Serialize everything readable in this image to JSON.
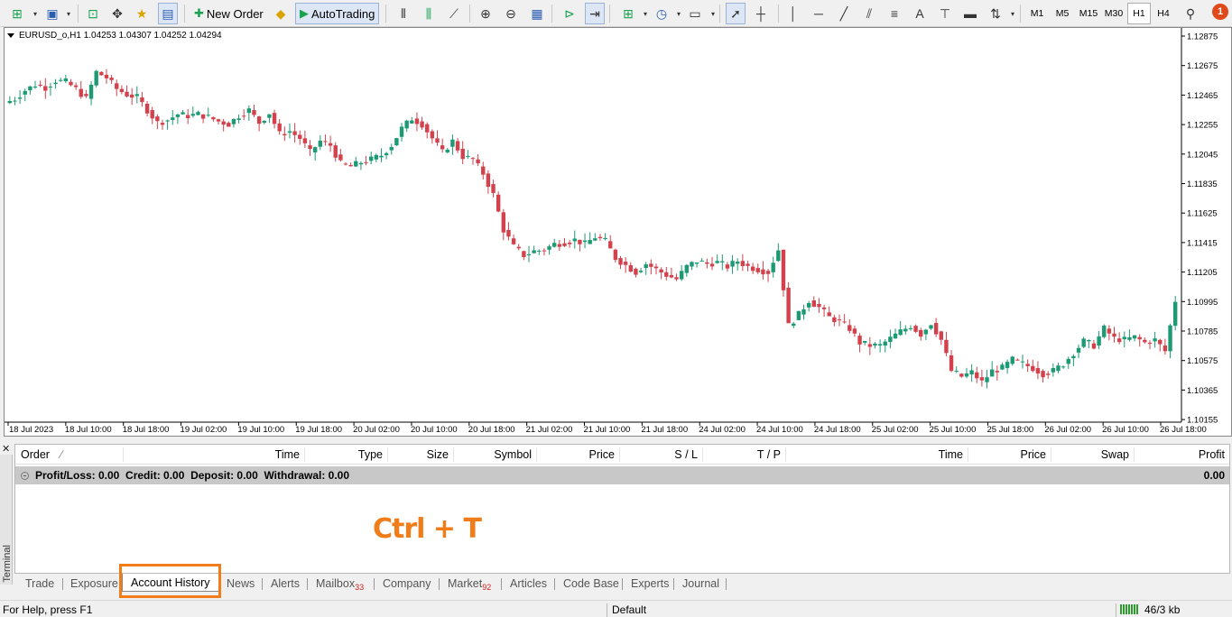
{
  "toolbar": {
    "new_order": "New Order",
    "auto_trading": "AutoTrading",
    "timeframes": [
      "M1",
      "M5",
      "M15",
      "M30",
      "H1",
      "H4"
    ],
    "active_timeframe": "H1",
    "tools": [
      "A"
    ],
    "notifications": "1"
  },
  "chart": {
    "title": "EURUSD_o,H1  1.04253 1.04307 1.04252 1.04294",
    "colors": {
      "up": "#1c9a73",
      "down": "#d3414d"
    }
  },
  "chart_data": {
    "type": "candlestick",
    "symbol": "EURUSD_o",
    "timeframe": "H1",
    "y_ticks": [
      "1.12875",
      "1.12675",
      "1.12465",
      "1.12255",
      "1.12045",
      "1.11835",
      "1.11625",
      "1.11415",
      "1.11205",
      "1.10995",
      "1.10785",
      "1.10575",
      "1.10365",
      "1.10155"
    ],
    "x_ticks": [
      "18 Jul 2023",
      "18 Jul 10:00",
      "18 Jul 18:00",
      "19 Jul 02:00",
      "19 Jul 10:00",
      "19 Jul 18:00",
      "20 Jul 02:00",
      "20 Jul 10:00",
      "20 Jul 18:00",
      "21 Jul 02:00",
      "21 Jul 10:00",
      "21 Jul 18:00",
      "24 Jul 02:00",
      "24 Jul 10:00",
      "24 Jul 18:00",
      "25 Jul 02:00",
      "25 Jul 10:00",
      "25 Jul 18:00",
      "26 Jul 02:00",
      "26 Jul 10:00",
      "26 Jul 18:00"
    ],
    "ylim": [
      1.1016,
      1.1292
    ],
    "close_path": [
      1.1243,
      1.1249,
      1.1253,
      1.1251,
      1.1256,
      1.1255,
      1.125,
      1.1243,
      1.1262,
      1.1258,
      1.125,
      1.1246,
      1.1244,
      1.1235,
      1.1226,
      1.1228,
      1.1232,
      1.1231,
      1.1232,
      1.123,
      1.1227,
      1.1225,
      1.1231,
      1.1235,
      1.1226,
      1.1233,
      1.1218,
      1.122,
      1.1215,
      1.1205,
      1.1213,
      1.121,
      1.1197,
      1.1195,
      1.1198,
      1.12,
      1.1203,
      1.121,
      1.1222,
      1.1229,
      1.1225,
      1.1215,
      1.1205,
      1.1213,
      1.1202,
      1.12,
      1.119,
      1.1175,
      1.115,
      1.1138,
      1.1132,
      1.1135,
      1.1136,
      1.114,
      1.1141,
      1.1143,
      1.114,
      1.1145,
      1.1142,
      1.113,
      1.1125,
      1.112,
      1.1126,
      1.1122,
      1.1118,
      1.1115,
      1.1124,
      1.1128,
      1.1126,
      1.1127,
      1.1124,
      1.1128,
      1.1124,
      1.1122,
      1.112,
      1.1136,
      1.1082,
      1.109,
      1.11,
      1.1095,
      1.1088,
      1.1085,
      1.108,
      1.107,
      1.1068,
      1.1068,
      1.1073,
      1.1078,
      1.1082,
      1.1076,
      1.1084,
      1.1072,
      1.105,
      1.1046,
      1.1049,
      1.1042,
      1.105,
      1.1052,
      1.1058,
      1.1055,
      1.1052,
      1.1048,
      1.105,
      1.1055,
      1.1063,
      1.1071,
      1.1068,
      1.108,
      1.1073,
      1.1072,
      1.1074,
      1.107,
      1.1072,
      1.1064,
      1.11
    ]
  },
  "terminal": {
    "label": "Terminal",
    "columns": [
      "Order",
      "Time",
      "Type",
      "Size",
      "Symbol",
      "Price",
      "S / L",
      "T / P",
      "Time",
      "Price",
      "Swap",
      "Profit"
    ],
    "summary": {
      "profit_loss": "Profit/Loss: 0.00",
      "credit": "Credit: 0.00",
      "deposit": "Deposit: 0.00",
      "withdrawal": "Withdrawal: 0.00",
      "total": "0.00"
    },
    "hint": "Ctrl + T",
    "tabs": [
      {
        "label": "Trade"
      },
      {
        "label": "Exposure"
      },
      {
        "label": "Account History"
      },
      {
        "label": "News"
      },
      {
        "label": "Alerts"
      },
      {
        "label": "Mailbox",
        "count": "33"
      },
      {
        "label": "Company"
      },
      {
        "label": "Market",
        "count": "92"
      },
      {
        "label": "Articles"
      },
      {
        "label": "Code Base"
      },
      {
        "label": "Experts"
      },
      {
        "label": "Journal"
      }
    ],
    "active_tab": "Account History",
    "highlight_color": "#f07d1a"
  },
  "status": {
    "help": "For Help, press F1",
    "profile": "Default",
    "traffic": "46/3 kb"
  }
}
